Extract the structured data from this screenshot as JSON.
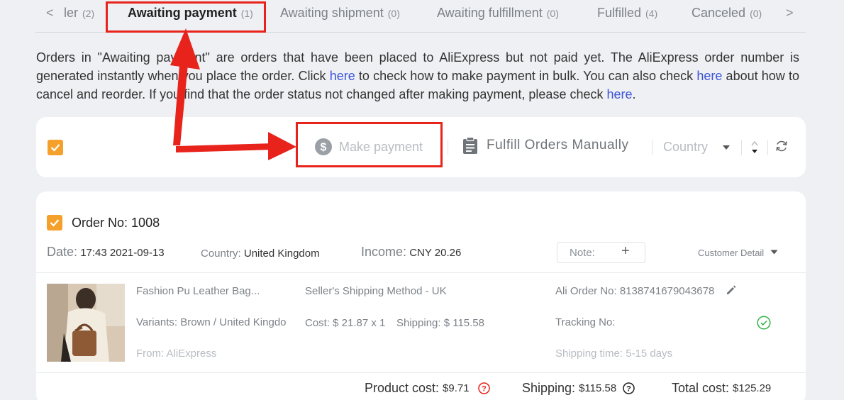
{
  "tabs": {
    "prev_arrow": "<",
    "next_arrow": ">",
    "items": [
      {
        "label": "ler",
        "count": "(2)"
      },
      {
        "label": "Awaiting payment",
        "count": "(1)"
      },
      {
        "label": "Awaiting shipment",
        "count": "(0)"
      },
      {
        "label": "Awaiting fulfillment",
        "count": "(0)"
      },
      {
        "label": "Fulfilled",
        "count": "(4)"
      },
      {
        "label": "Canceled",
        "count": "(0)"
      }
    ]
  },
  "description": {
    "p1": "Orders in \"Awaiting payment\" are orders that have been placed to AliExpress but not paid yet. The AliExpress order number is generated instantly when you place the order. Click ",
    "link1": "here",
    "p2": " to check how to make payment in bulk. You can also check ",
    "link2": "here",
    "p3": " about how to cancel and reorder. If you find that the order status not changed after making payment, please check ",
    "link3": "here",
    "p4": "."
  },
  "toolbar": {
    "make_payment": "Make payment",
    "fulfill_manually": "Fulfill Orders Manually",
    "country_placeholder": "Country"
  },
  "order": {
    "order_no_label": "Order No:",
    "order_no": "1008",
    "date_label": "Date:",
    "date": "17:43 2021-09-13",
    "country_label": "Country:",
    "country": "United Kingdom",
    "income_label": "Income:",
    "income": "CNY 20.26",
    "note_label": "Note:",
    "note_plus": "+",
    "customer_detail": "Customer Detail",
    "product_name": "Fashion Pu Leather Bag...",
    "variants": "Variants: Brown / United Kingdo",
    "from": "From: AliExpress",
    "shipping_method": "Seller's Shipping Method - UK",
    "cost": "Cost: $ 21.87 x 1",
    "shipping": "Shipping: $ 115.58",
    "ali_order_no": "Ali Order No: 8138741679043678",
    "tracking_no": "Tracking No:",
    "shipping_time": "Shipping time: 5-15 days",
    "product_cost_label": "Product cost:",
    "product_cost": "$9.71",
    "shipping_total_label": "Shipping:",
    "shipping_total": "$115.58",
    "total_cost_label": "Total cost:",
    "total_cost": "$125.29"
  },
  "colors": {
    "accent_orange": "#f4a02a",
    "link_blue": "#3d55d6",
    "annotation_red": "#e8231c",
    "success_green": "#2fb344"
  }
}
